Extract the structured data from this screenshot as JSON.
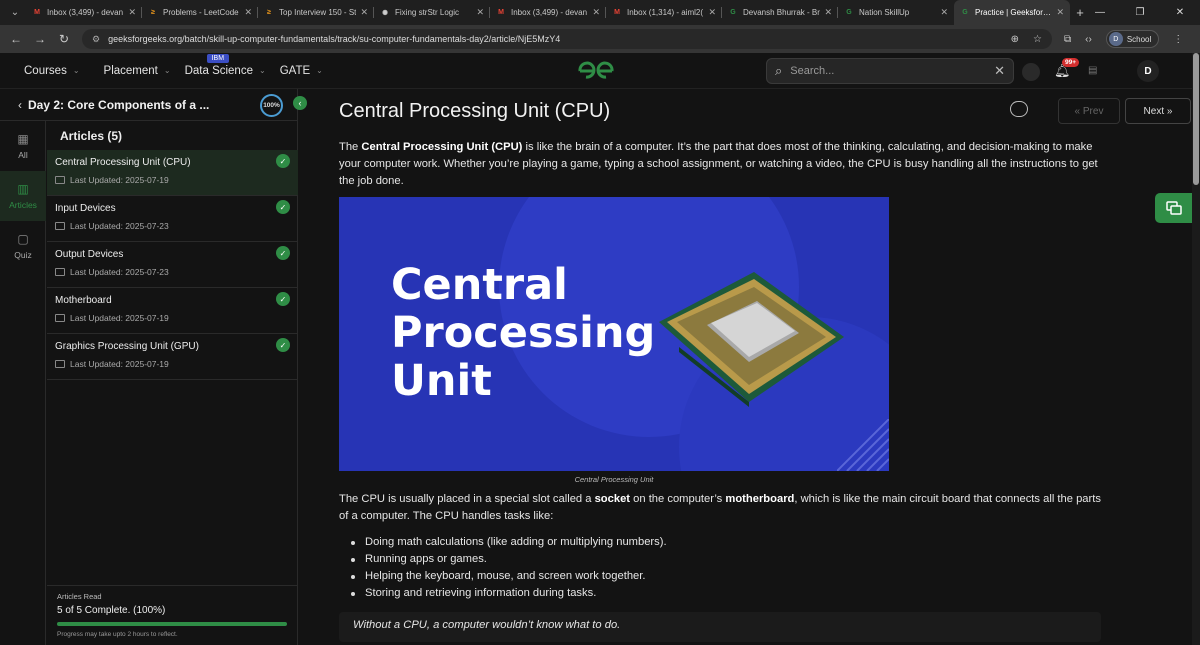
{
  "browser": {
    "tabs": [
      {
        "title": "Inbox (3,499) - devan",
        "icon": "gmail-icon",
        "color": "#ea4335",
        "glyph": "M"
      },
      {
        "title": "Problems - LeetCode",
        "icon": "leetcode-icon",
        "color": "#f89f1b",
        "glyph": "≥"
      },
      {
        "title": "Top Interview 150 - St",
        "icon": "leetcode-icon",
        "color": "#f89f1b",
        "glyph": "≥"
      },
      {
        "title": "Fixing strStr Logic",
        "icon": "chatgpt-icon",
        "color": "#cccccc",
        "glyph": "✺"
      },
      {
        "title": "Inbox (3,499) - devan",
        "icon": "gmail-icon",
        "color": "#ea4335",
        "glyph": "M"
      },
      {
        "title": "Inbox (1,314) - aiml2(",
        "icon": "gmail-icon",
        "color": "#ea4335",
        "glyph": "M"
      },
      {
        "title": "Devansh Bhurrak - Br",
        "icon": "gfg-icon",
        "color": "#2f8d46",
        "glyph": "G"
      },
      {
        "title": "Nation SkillUp",
        "icon": "gfg-icon",
        "color": "#2f8d46",
        "glyph": "G"
      },
      {
        "title": "Practice | GeeksforGe",
        "icon": "gfg-icon",
        "color": "#2f8d46",
        "glyph": "G"
      }
    ],
    "url": "geeksforgeeks.org/batch/skill-up-computer-fundamentals/track/su-computer-fundamentals-day2/article/NjE5MzY4",
    "profile_label": "School",
    "profile_initial": "D"
  },
  "topnav": {
    "items": [
      "Courses",
      "Placement",
      "Data Science",
      "GATE"
    ],
    "ibm_badge": "IBM",
    "logo_text": "GG",
    "search_placeholder": "Search...",
    "notif_count": "99+",
    "avatar_initial": "D"
  },
  "sidebar": {
    "title": "Day 2: Core Components of a ...",
    "progress_ring": "100%",
    "rail": [
      {
        "label": "All",
        "icon": "grid-icon",
        "glyph": "▦"
      },
      {
        "label": "Articles",
        "icon": "book-icon",
        "glyph": "▥"
      },
      {
        "label": "Quiz",
        "icon": "clipboard-icon",
        "glyph": "▢"
      }
    ],
    "articles_heading": "Articles (5)",
    "articles": [
      {
        "name": "Central Processing Unit (CPU)",
        "date": "Last Updated: 2025-07-19"
      },
      {
        "name": "Input Devices",
        "date": "Last Updated: 2025-07-23"
      },
      {
        "name": "Output Devices",
        "date": "Last Updated: 2025-07-23"
      },
      {
        "name": "Motherboard",
        "date": "Last Updated: 2025-07-19"
      },
      {
        "name": "Graphics Processing Unit (GPU)",
        "date": "Last Updated: 2025-07-19"
      }
    ],
    "progress": {
      "label": "Articles Read",
      "summary": "5 of 5 Complete. (100%)",
      "fraction": 1.0,
      "note": "Progress may take upto 2 hours to reflect."
    }
  },
  "article": {
    "title": "Central Processing Unit (CPU)",
    "prev_label": "« Prev",
    "next_label": "Next »",
    "intro": "The Central Processing Unit (CPU) is like the brain of a computer. It’s the part that does most of the thinking, calculating, and decision-making to make your computer work. Whether you’re playing a game, typing a school assignment, or watching a video, the CPU is busy handling all the instructions to get the job done.",
    "intro_bold": "Central Processing Unit (CPU)",
    "hero_lines": [
      "Central",
      "Processing",
      "Unit"
    ],
    "caption": "Central Processing Unit",
    "para2": "The CPU is usually placed in a special slot called a socket on the computer’s motherboard, which is like the main circuit board that connects all the parts of a computer. The CPU handles tasks like:",
    "bullets": [
      "Doing math calculations (like adding or multiplying numbers).",
      "Running apps or games.",
      "Helping the keyboard, mouse, and screen work together.",
      "Storing and retrieving information during tasks."
    ],
    "quote": "Without a CPU, a computer wouldn’t know what to do."
  }
}
